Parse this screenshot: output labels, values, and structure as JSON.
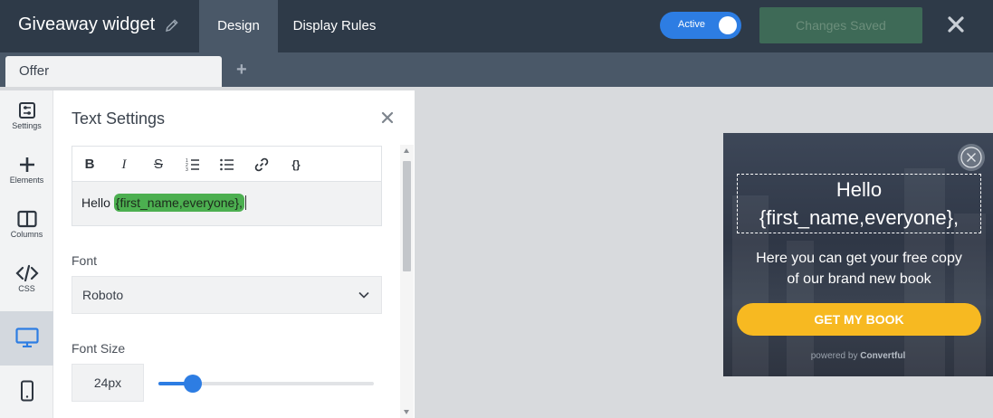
{
  "header": {
    "title": "Giveaway widget",
    "tabs": [
      {
        "label": "Design",
        "active": true
      },
      {
        "label": "Display Rules",
        "active": false
      }
    ],
    "toggle_label": "Active",
    "save_button": "Changes Saved"
  },
  "subbar": {
    "tabs": [
      {
        "label": "Offer"
      }
    ],
    "add_label": "+"
  },
  "rail": {
    "items": [
      {
        "label": "Settings",
        "icon": "settings-icon"
      },
      {
        "label": "Elements",
        "icon": "plus-icon"
      },
      {
        "label": "Columns",
        "icon": "columns-icon"
      },
      {
        "label": "CSS",
        "icon": "code-icon"
      },
      {
        "label": "",
        "icon": "desktop-icon",
        "active": true
      },
      {
        "label": "",
        "icon": "mobile-icon"
      }
    ]
  },
  "panel": {
    "title": "Text Settings",
    "toolbar": [
      {
        "name": "bold",
        "glyph": "B"
      },
      {
        "name": "italic",
        "glyph": "I"
      },
      {
        "name": "strikethrough",
        "glyph": "S"
      },
      {
        "name": "ordered-list",
        "glyph": ""
      },
      {
        "name": "bullet-list",
        "glyph": ""
      },
      {
        "name": "link",
        "glyph": ""
      },
      {
        "name": "merge-tag",
        "glyph": "{}"
      }
    ],
    "editor": {
      "text": "Hello",
      "tag": "{first_name,everyone},"
    },
    "font_label": "Font",
    "font_value": "Roboto",
    "font_size_label": "Font Size",
    "font_size_value": "24px",
    "font_size_slider": 0.16
  },
  "widget": {
    "heading_line1": "Hello",
    "heading_line2": "{first_name,everyone},",
    "subtitle_line1": "Here you can get your free copy",
    "subtitle_line2": "of our brand new book",
    "cta": "GET MY BOOK",
    "powered_prefix": "powered by",
    "powered_brand": "Convertful"
  },
  "colors": {
    "topbar": "#2e3a48",
    "accent_blue": "#2d7de3",
    "tag_green": "#4caf50",
    "cta_yellow": "#f7b921"
  }
}
